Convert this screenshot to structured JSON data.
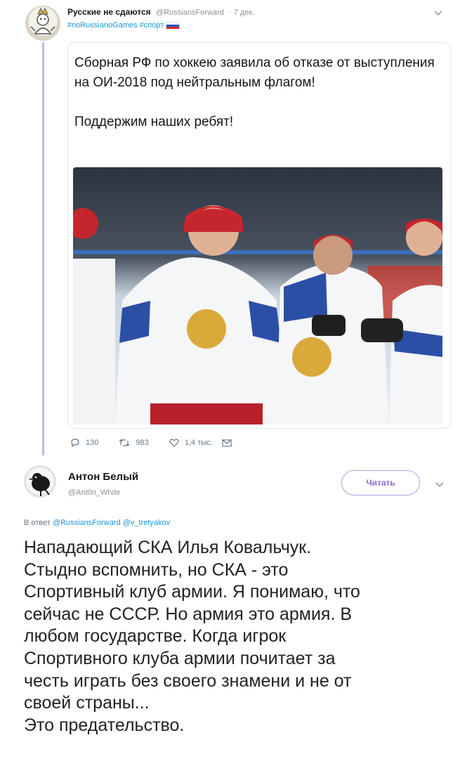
{
  "tweet": {
    "author_name": "Русские не сдаются",
    "author_handle": "@RussiansForward",
    "time": "· 7 дек.",
    "hashtags": "#noRussianoGames #спорт",
    "text": "Сборная РФ по хоккею заявила об отказе от выступления на ОИ-2018 под нейтральным флагом!\n\nПоддержим наших ребят!",
    "image_alt": "Russian hockey team players in white jerseys celebrating",
    "stats": {
      "replies": "130",
      "retweets": "983",
      "likes": "1,4 тыс."
    }
  },
  "reply": {
    "author_name": "Антон Белый",
    "author_handle": "@Ant0n_White",
    "follow_label": "Читать",
    "reply_prefix": "В ответ",
    "reply_to_1": "@RussiansForward",
    "reply_to_2": "@v_tretyakov",
    "text": "Нападающий СКА Илья Ковальчук.\nСтыдно вспомнить, но СКА - это\nСпортивный клуб армии. Я понимаю, что\nсейчас не СССР. Но армия это армия. В\nлюбом государстве. Когда игрок\nСпортивного клуба армии почитает за\nчесть играть без своего знамени и не от\nсвоей страны...\nЭто предательство."
  },
  "colors": {
    "link": "#1b95e0",
    "thread_line": "#c7b6e5",
    "follow_border": "#b99de6",
    "meta": "#8a9199"
  },
  "icons": [
    "chevron-down-icon",
    "reply-icon",
    "retweet-icon",
    "like-icon",
    "message-icon",
    "flag-ru-icon"
  ]
}
